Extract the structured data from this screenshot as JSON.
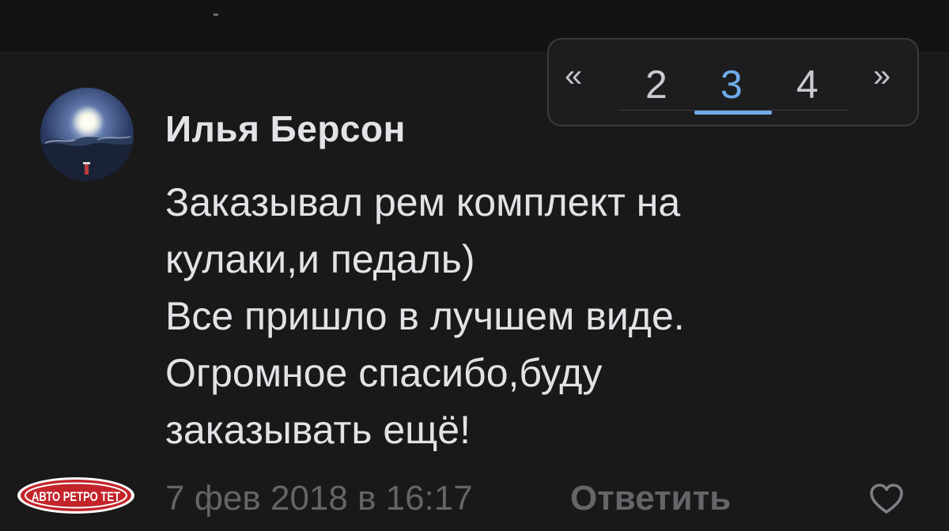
{
  "pagination": {
    "prev_label": "«",
    "next_label": "»",
    "pages": [
      "2",
      "3",
      "4"
    ],
    "current_page": "3"
  },
  "comment": {
    "author": "Илья Берсон",
    "lines": [
      "Заказывал рем комплект на",
      "кулаки,и педаль)",
      "Все пришло в лучшем виде.",
      "Огромное спасибо,буду",
      "заказывать ещё!"
    ],
    "date": "7 фев 2018 в 16:17",
    "reply_label": "Ответить"
  },
  "icons": {
    "like": "heart-outline-icon",
    "avatar": "moon-sky-avatar"
  },
  "watermark": {
    "text": "АВТО РЕТРО ТЕТ"
  },
  "colors": {
    "background": "#19191a",
    "accent": "#71aaeb",
    "text": "#e1e3e6",
    "muted": "#636568"
  }
}
